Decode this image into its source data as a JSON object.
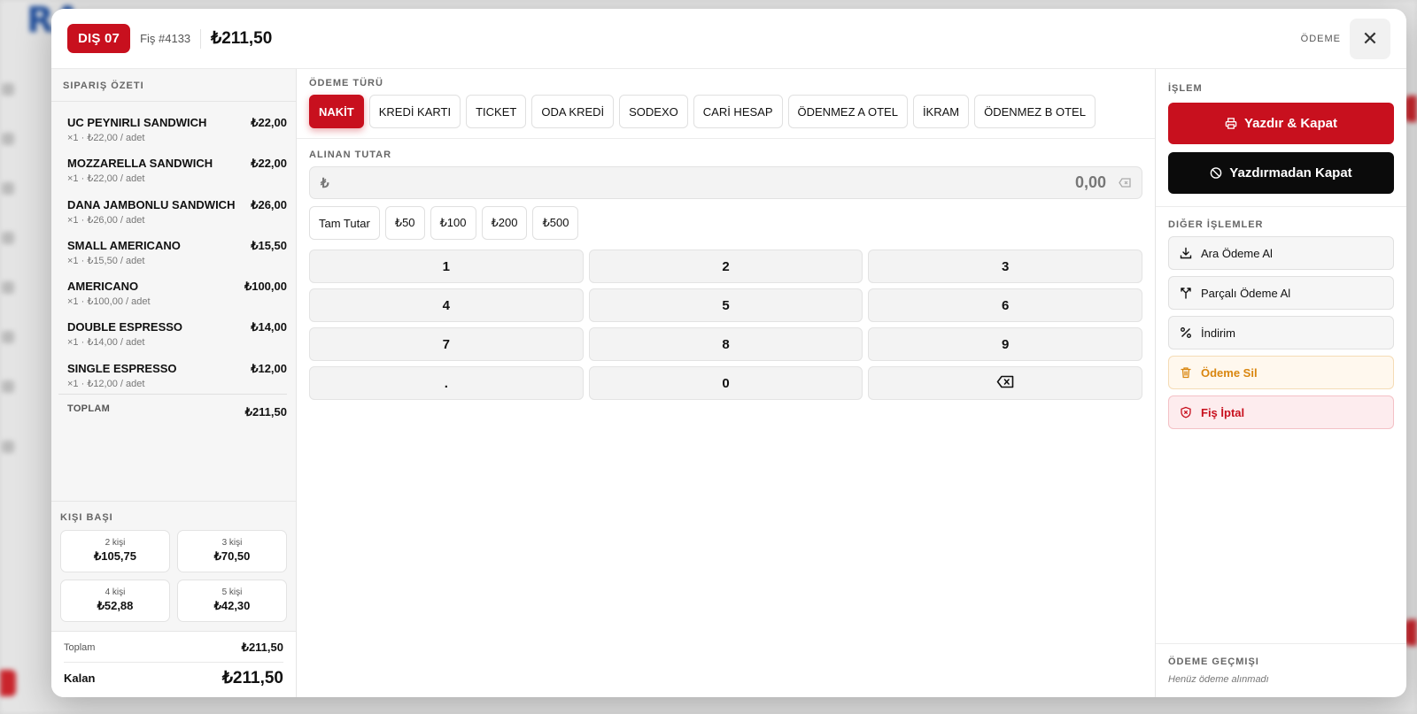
{
  "header": {
    "table": "DIŞ 07",
    "receipt": "Fiş #4133",
    "total": "₺211,50",
    "label": "ÖDEME",
    "close": "✕"
  },
  "order": {
    "title": "SIPARIŞ ÖZETI",
    "items": [
      {
        "name": "UC PEYNIRLI SANDWICH",
        "sub": "×1 · ₺22,00 / adet",
        "price": "₺22,00"
      },
      {
        "name": "MOZZARELLA SANDWICH",
        "sub": "×1 · ₺22,00 / adet",
        "price": "₺22,00"
      },
      {
        "name": "DANA JAMBONLU SANDWICH",
        "sub": "×1 · ₺26,00 / adet",
        "price": "₺26,00"
      },
      {
        "name": "SMALL AMERICANO",
        "sub": "×1 · ₺15,50 / adet",
        "price": "₺15,50"
      },
      {
        "name": "AMERICANO",
        "sub": "×1 · ₺100,00 / adet",
        "price": "₺100,00"
      },
      {
        "name": "DOUBLE ESPRESSO",
        "sub": "×1 · ₺14,00 / adet",
        "price": "₺14,00"
      },
      {
        "name": "SINGLE ESPRESSO",
        "sub": "×1 · ₺12,00 / adet",
        "price": "₺12,00"
      }
    ],
    "total_label": "TOPLAM",
    "total_value": "₺211,50"
  },
  "per_person": {
    "title": "KIŞI BAŞI",
    "cards": [
      {
        "count": "2 kişi",
        "value": "₺105,75"
      },
      {
        "count": "3 kişi",
        "value": "₺70,50"
      },
      {
        "count": "4 kişi",
        "value": "₺52,88"
      },
      {
        "count": "5 kişi",
        "value": "₺42,30"
      }
    ]
  },
  "summary": {
    "total_label": "Toplam",
    "total_value": "₺211,50",
    "remaining_label": "Kalan",
    "remaining_value": "₺211,50"
  },
  "payment": {
    "title": "ÖDEME TÜRÜ",
    "types": [
      "NAKİT",
      "KREDİ KARTI",
      "TICKET",
      "ODA KREDİ",
      "SODEXO",
      "CARİ HESAP",
      "ÖDENMEZ A OTEL",
      "İKRAM",
      "ÖDENMEZ B OTEL"
    ],
    "active": "NAKİT"
  },
  "amount": {
    "title": "ALINAN TUTAR",
    "currency": "₺",
    "value": "0,00",
    "quick": [
      "Tam Tutar",
      "₺50",
      "₺100",
      "₺200",
      "₺500"
    ]
  },
  "keypad": {
    "keys": [
      "1",
      "2",
      "3",
      "4",
      "5",
      "6",
      "7",
      "8",
      "9",
      ".",
      "0"
    ]
  },
  "actions": {
    "title": "İŞLEM",
    "print_close": "Yazdır & Kapat",
    "close_no_print": "Yazdırmadan Kapat"
  },
  "other": {
    "title": "DIĞER İŞLEMLER",
    "interim": "Ara Ödeme Al",
    "partial": "Parçalı Ödeme Al",
    "discount": "İndirim",
    "delete_payment": "Ödeme Sil",
    "cancel_receipt": "Fiş İptal"
  },
  "history": {
    "title": "ÖDEME GEÇMIŞI",
    "empty": "Henüz ödeme alınmadı"
  },
  "colors": {
    "accent": "#c8101e",
    "dark": "#0b0b0b",
    "warning": "#d9860f"
  }
}
